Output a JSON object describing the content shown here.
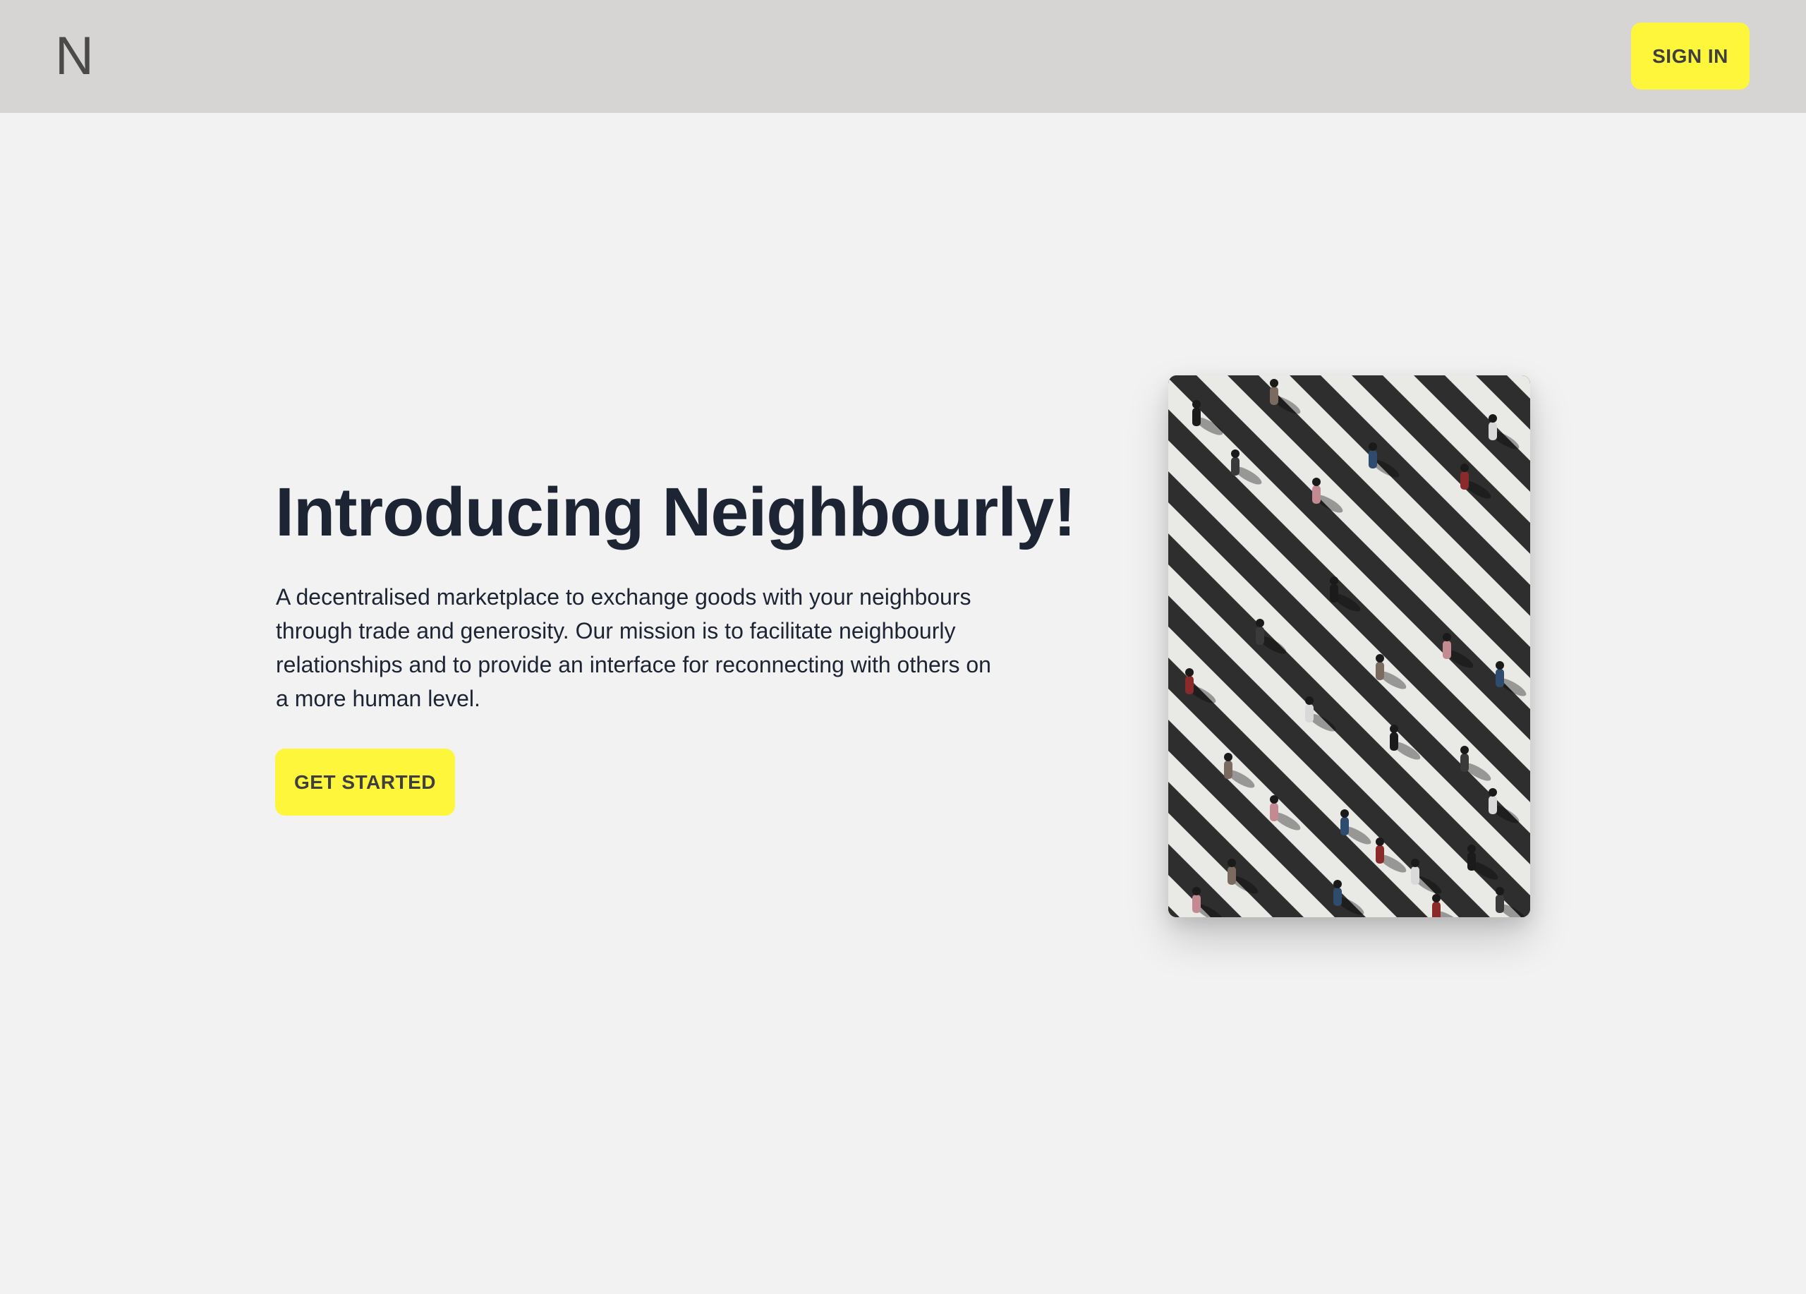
{
  "header": {
    "logo_text": "N",
    "sign_in_label": "SIGN IN"
  },
  "hero": {
    "title": "Introducing Neighbourly!",
    "description": "A decentralised marketplace to exchange goods with your neighbours through trade and generosity. Our mission is to facilitate neighbourly relationships and to provide an interface for reconnecting with others on a more human level.",
    "cta_label": "GET STARTED"
  },
  "image": {
    "subject": "aerial-crosswalk-pedestrians"
  },
  "colors": {
    "accent": "#fdf63a",
    "header_bg": "#d6d5d3",
    "page_bg": "#f2f2f2",
    "heading_text": "#1d2433"
  }
}
